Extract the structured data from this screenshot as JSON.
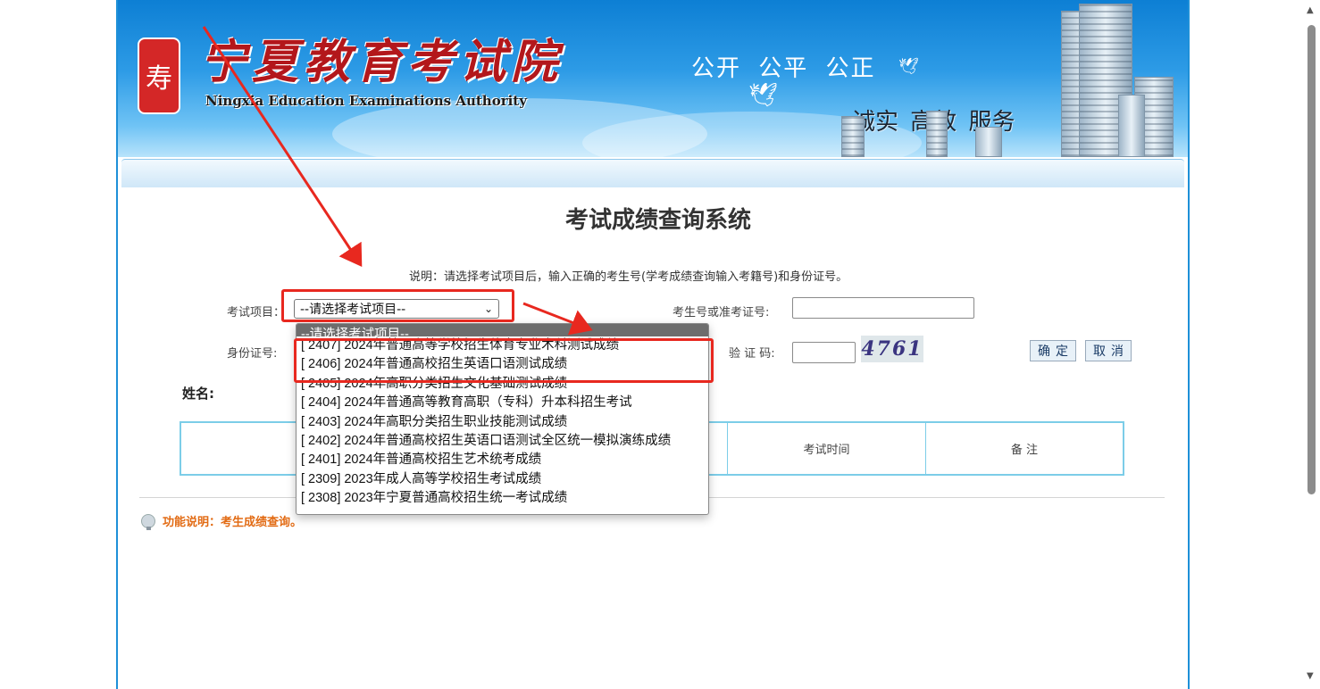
{
  "banner": {
    "logo_cn": "宁夏教育考试院",
    "logo_en": "Ningxia Education Examinations Authority",
    "slogan_line1": "公开  公平  公正",
    "slogan_line2": "诚实  高效  服务"
  },
  "page_title": "考试成绩查询系统",
  "notice": "说明：请选择考试项目后，输入正确的考生号(学考成绩查询输入考籍号)和身份证号。",
  "form": {
    "exam_label": "考试项目：",
    "exam_selected": "--请选择考试项目--",
    "candidate_label": "考生号或准考证号:",
    "candidate_value": "",
    "id_label": "身份证号:",
    "id_value": "",
    "captcha_label": "验 证 码:",
    "captcha_value": "",
    "captcha_image_text": "4761",
    "confirm_button": "确定",
    "cancel_button": "取消"
  },
  "name_label": "姓名:",
  "result_table": {
    "headers": [
      "",
      "",
      "",
      "考试时间",
      "备 注"
    ]
  },
  "function_note": "功能说明：考生成绩查询。",
  "dropdown": {
    "options": [
      "--请选择考试项目--",
      "[ 2407] 2024年普通高等学校招生体育专业术科测试成绩",
      "[ 2406] 2024年普通高校招生英语口语测试成绩",
      "[ 2405] 2024年高职分类招生文化基础测试成绩",
      "[ 2404] 2024年普通高等教育高职（专科）升本科招生考试",
      "[ 2403] 2024年高职分类招生职业技能测试成绩",
      "[ 2402] 2024年普通高校招生英语口语测试全区统一模拟演练成绩",
      "[ 2401] 2024年普通高校招生艺术统考成绩",
      "[ 2309] 2023年成人高等学校招生考试成绩",
      "[ 2308] 2023年宁夏普通高校招生统一考试成绩"
    ]
  },
  "colors": {
    "banner_blue": "#0d7fd4",
    "logo_red": "#b3171b",
    "annotation_red": "#e8281f",
    "note_orange": "#e26b14",
    "table_border": "#7ccde8"
  }
}
